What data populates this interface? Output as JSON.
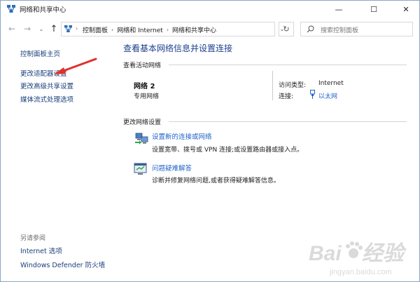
{
  "window": {
    "title": "网络和共享中心",
    "controls": {
      "minimize": "—",
      "maximize": "☐",
      "close": "✕"
    }
  },
  "navbar": {
    "back": "←",
    "forward": "→",
    "recent": "⌄",
    "up": "↑",
    "breadcrumbs": [
      "控制面板",
      "网络和 Internet",
      "网络和共享中心"
    ],
    "separator": "›",
    "dropdown": "⌄",
    "refresh": "↻",
    "search_placeholder": "搜索控制面板"
  },
  "sidebar": {
    "home": "控制面板主页",
    "items": [
      "更改适配器设置",
      "更改高级共享设置",
      "媒体流式处理选项"
    ],
    "see_also_label": "另请参阅",
    "see_also": [
      "Internet 选项",
      "Windows Defender 防火墙"
    ]
  },
  "main": {
    "title": "查看基本网络信息并设置连接",
    "active_networks_label": "查看活动网络",
    "network": {
      "name": "网络 2",
      "type": "专用网络",
      "access_type_label": "访问类型:",
      "access_type_value": "Internet",
      "connections_label": "连接:",
      "connections_value": "以太网"
    },
    "change_settings_label": "更改网络设置",
    "tasks": [
      {
        "link": "设置新的连接或网络",
        "desc": "设置宽带、拨号或 VPN 连接;或设置路由器或接入点。",
        "icon": "network-setup-icon"
      },
      {
        "link": "问题疑难解答",
        "desc": "诊断并修复网络问题,或者获得疑难解答信息。",
        "icon": "troubleshoot-icon"
      }
    ]
  },
  "annotation": {
    "arrow_color": "#e0312b"
  },
  "watermark": {
    "brand": "Baidu",
    "suffix": "经验",
    "url": "jingyan.baidu.com"
  },
  "colors": {
    "link": "#1f63c8",
    "title": "#1e3f8c",
    "sidebar_link": "#1a3e7a"
  }
}
